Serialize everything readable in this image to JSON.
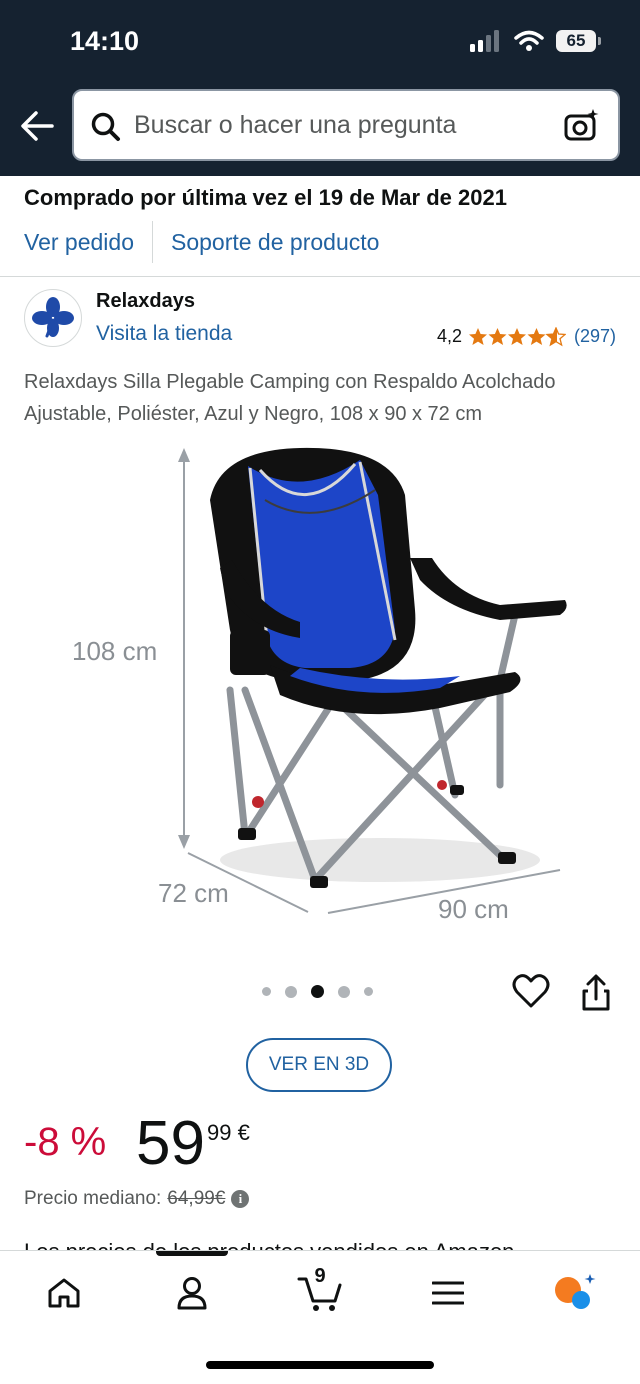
{
  "status_bar": {
    "time": "14:10",
    "battery": "65"
  },
  "search": {
    "placeholder": "Buscar o hacer una pregunta"
  },
  "order": {
    "purchased_text": "Comprado por última vez el 19 de Mar de 2021",
    "view_order": "Ver pedido",
    "product_support": "Soporte de producto"
  },
  "brand": {
    "name": "Relaxdays",
    "visit_store": "Visita la tienda",
    "rating_value": "4,2",
    "rating_stars": 4.2,
    "rating_count": "(297)"
  },
  "product": {
    "title": "Relaxdays Silla Plegable Camping con Respaldo Acolchado Ajustable, Poliéster, Azul y Negro, 108 x 90 x 72 cm",
    "dim_height": "108 cm",
    "dim_depth": "72 cm",
    "dim_width": "90 cm",
    "image_count": 5,
    "active_image": 3,
    "view_3d": "VER EN 3D"
  },
  "price": {
    "discount": "-8 %",
    "whole": "59",
    "fraction": "99 €",
    "median_label": "Precio mediano:",
    "median_value": "64,99€"
  },
  "partial_text": "Los precios de los productos vendidos en Amazon",
  "bottom_nav": {
    "cart_count": "9"
  },
  "colors": {
    "header_bg": "#152230",
    "link": "#2162a1",
    "discount": "#cc0c39",
    "star": "#e47911"
  }
}
